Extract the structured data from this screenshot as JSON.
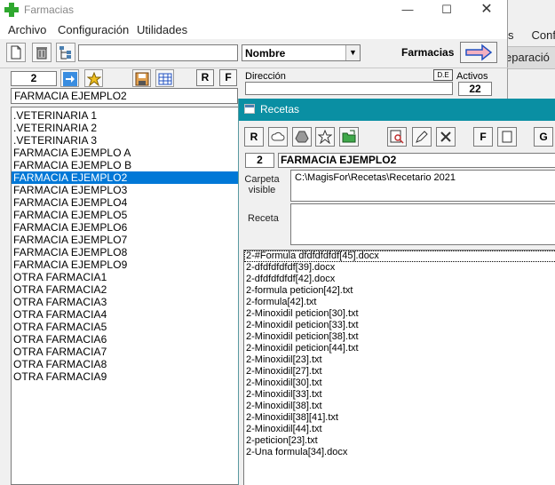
{
  "main_window": {
    "title": "Farmacias",
    "menu": [
      "Archivo",
      "Configuración",
      "Utilidades"
    ],
    "sort_combo": "Nombre",
    "farmacias_label": "Farmacias",
    "record_number": "2",
    "r_button": "R",
    "f_button": "F",
    "selected_name": "FARMACIA EJEMPLO2",
    "direccion_label": "Dirección",
    "de_button": "D.E",
    "activos_label": "Activos",
    "activos_value": "22",
    "list": [
      ".VETERINARIA 1",
      ".VETERINARIA 2",
      ".VETERINARIA 3",
      "FARMACIA EJEMPLO A",
      "FARMACIA EJEMPLO B",
      "FARMACIA EJEMPLO2",
      "FARMACIA EJEMPLO3",
      "FARMACIA EJEMPLO4",
      "FARMACIA EJEMPLO5",
      "FARMACIA EJEMPLO6",
      "FARMACIA EJEMPLO7",
      "FARMACIA EJEMPLO8",
      "FARMACIA EJEMPLO9",
      "OTRA FARMACIA1",
      "OTRA FARMACIA2",
      "OTRA FARMACIA3",
      "OTRA FARMACIA4",
      "OTRA FARMACIA5",
      "OTRA FARMACIA6",
      "OTRA FARMACIA7",
      "OTRA FARMACIA8",
      "OTRA FARMACIA9"
    ],
    "selected_index": 5
  },
  "background_window": {
    "menu_fragment": [
      "s",
      "Confi"
    ],
    "toolbar_fragment": "eparació"
  },
  "recetas_window": {
    "title": "Recetas",
    "r_button": "R",
    "f_button": "F",
    "g_button": "G",
    "record_number": "2",
    "record_name": "FARMACIA EJEMPLO2",
    "carpeta_label": "Carpeta visible",
    "carpeta_value": "C:\\MagisFor\\Recetas\\Recetario 2021",
    "receta_label": "Receta",
    "receta_value": "",
    "files": [
      "2-#Formula dfdfdfdfdf[45].docx",
      "2-dfdfdfdfdf[39].docx",
      "2-dfdfdfdfdf[42].docx",
      "2-formula peticion[42].txt",
      "2-formula[42].txt",
      "2-Minoxidil peticion[30].txt",
      "2-Minoxidil peticion[33].txt",
      "2-Minoxidil peticion[38].txt",
      "2-Minoxidil peticion[44].txt",
      "2-Minoxidil[23].txt",
      "2-Minoxidil[27].txt",
      "2-Minoxidil[30].txt",
      "2-Minoxidil[33].txt",
      "2-Minoxidil[38].txt",
      "2-Minoxidil[38][41].txt",
      "2-Minoxidil[44].txt",
      "2-peticion[23].txt",
      "2-Una formula[34].docx"
    ]
  },
  "colors": {
    "selection": "#0078d7",
    "recetas_titlebar": "#0a8fa3",
    "window_bg": "#f0f0f0"
  }
}
